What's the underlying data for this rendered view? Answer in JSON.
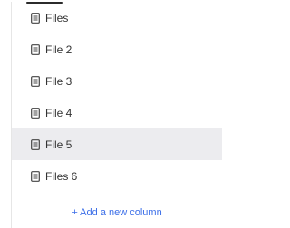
{
  "file_list": {
    "items": [
      {
        "label": "Files",
        "icon": "file-icon",
        "highlighted": false
      },
      {
        "label": "File 2",
        "icon": "file-icon",
        "highlighted": false
      },
      {
        "label": "File 3",
        "icon": "file-icon",
        "highlighted": false
      },
      {
        "label": "File 4",
        "icon": "file-icon",
        "highlighted": false
      },
      {
        "label": "File 5",
        "icon": "file-icon",
        "highlighted": true
      },
      {
        "label": "Files 6",
        "icon": "file-icon",
        "highlighted": false
      }
    ],
    "add_column_label": "+ Add a new column"
  },
  "colors": {
    "text": "#333333",
    "link": "#3b6ee8",
    "highlight_bg": "#ececef",
    "accent_bar": "#2b2b2b"
  }
}
